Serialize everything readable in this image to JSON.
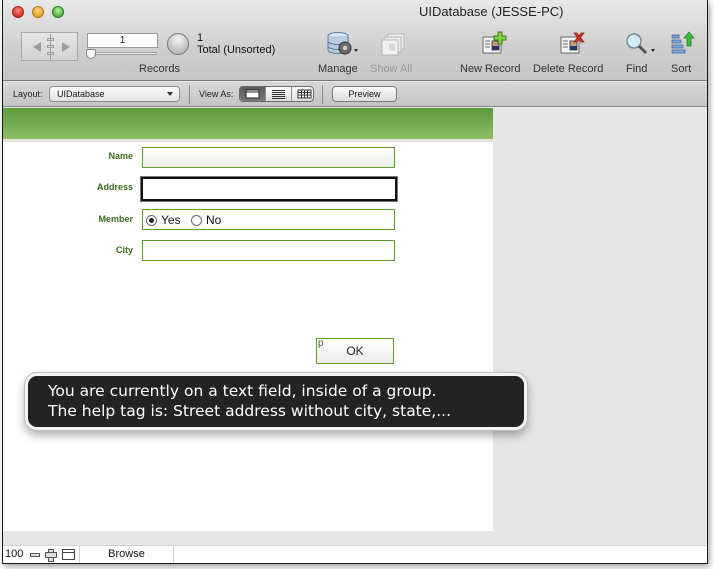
{
  "window": {
    "title": "UIDatabase (JESSE-PC)"
  },
  "toolbar": {
    "record_number": "1",
    "found_count": "1",
    "total_status": "Total (Unsorted)",
    "records_label": "Records",
    "manage_label": "Manage",
    "show_all_label": "Show All",
    "new_record_label": "New Record",
    "delete_record_label": "Delete Record",
    "find_label": "Find",
    "sort_label": "Sort"
  },
  "layoutbar": {
    "layout_label": "Layout:",
    "layout_value": "UIDatabase",
    "view_as_label": "View As:",
    "view_modes": [
      "form",
      "list",
      "table"
    ],
    "active_view": "form",
    "preview_label": "Preview"
  },
  "form": {
    "accent_color": "#5e9a2e",
    "fields": [
      {
        "label": "Name",
        "value": ""
      },
      {
        "label": "Address",
        "value": "",
        "focused": true
      },
      {
        "label": "Member",
        "options": [
          "Yes",
          "No"
        ],
        "selected": "Yes"
      },
      {
        "label": "City",
        "value": ""
      }
    ],
    "ok_prefix": "p",
    "ok_label": "OK"
  },
  "tooltip": {
    "line1": "You are currently on a text field, inside of a group.",
    "line2": "The help tag is: Street address without city, state,..."
  },
  "statusbar": {
    "zoom_level": "100",
    "mode": "Browse"
  }
}
